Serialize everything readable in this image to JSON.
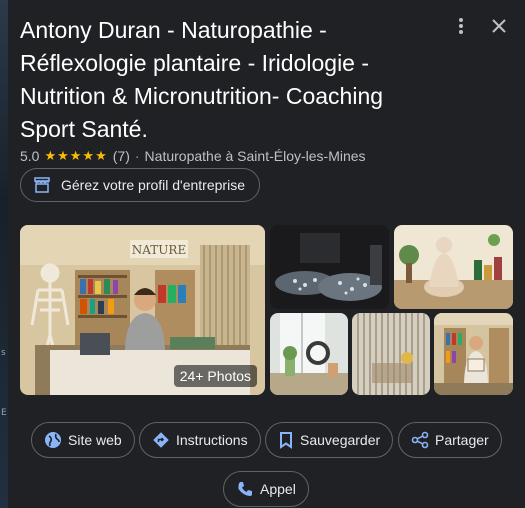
{
  "business": {
    "name": "Antony Duran - Naturopathie - Réflexologie plantaire - Iridologie - Nutrition & Micronutrition- Coaching Sport Santé.",
    "rating": "5.0",
    "stars": "★★★★★",
    "review_count": "(7)",
    "category": "Naturopathe à Saint-Éloy-les-Mines"
  },
  "profile_button": {
    "label": "Gérez votre profil d'entreprise",
    "icon": "storefront-icon"
  },
  "top_icons": [
    "more-vert-icon",
    "close-icon"
  ],
  "photos": {
    "count_label": "24+ Photos",
    "sign_text": "NATURE"
  },
  "actions": [
    {
      "label": "Site web",
      "icon": "globe-icon"
    },
    {
      "label": "Instructions",
      "icon": "directions-icon"
    },
    {
      "label": "Sauvegarder",
      "icon": "bookmark-icon"
    },
    {
      "label": "Partager",
      "icon": "share-icon"
    },
    {
      "label": "Appel",
      "icon": "phone-icon"
    }
  ],
  "left_edge_marks": [
    "s",
    "E"
  ],
  "colors": {
    "background": "#202124",
    "accent": "#8ab4f8",
    "stars": "#fbbc04",
    "border": "#5f6368"
  }
}
